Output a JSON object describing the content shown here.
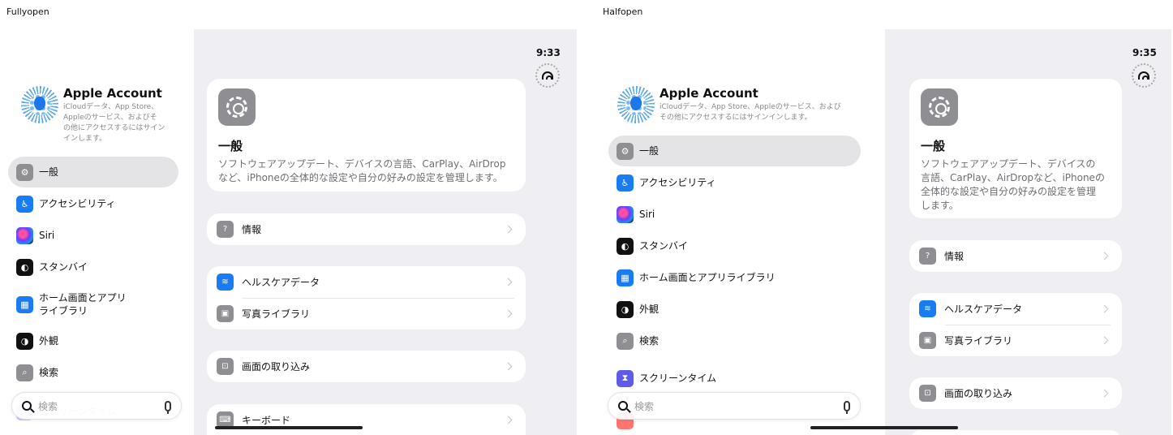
{
  "captions": {
    "left": "Fullyopen",
    "right": "Halfopen"
  },
  "status": {
    "time_left": "9:33",
    "time_right": "9:35"
  },
  "account": {
    "title": "Apple Account",
    "subtitle_left": [
      "iCloudデータ、App Store、",
      "Appleのサービス、およびそ",
      "の他にアクセスするにはサイン",
      "インします。"
    ],
    "subtitle_right": [
      "iCloudデータ、App Store、Appleのサービス、および",
      "その他にアクセスするにはサインインします。"
    ]
  },
  "sidebar": {
    "items": [
      {
        "label": "一般",
        "icon": "gear-icon"
      },
      {
        "label": "アクセシビリティ",
        "icon": "accessibility-icon"
      },
      {
        "label": "Siri",
        "icon": "siri-icon"
      },
      {
        "label": "スタンバイ",
        "icon": "standby-icon"
      },
      {
        "label": "ホーム画面とアプリライブラリ",
        "icon": "home-screen-icon"
      },
      {
        "label": "外観",
        "icon": "appearance-icon"
      },
      {
        "label": "検索",
        "icon": "search-icon"
      },
      {
        "label": "スクリーンタイム",
        "icon": "screen-time-icon"
      }
    ],
    "home_label_left": [
      "ホーム画面とアプリ",
      "ライブラリ"
    ]
  },
  "search": {
    "placeholder": "検索"
  },
  "detail": {
    "hero": {
      "title": "一般",
      "desc_left": [
        "ソフトウェアアップデート、デバイスの言語、CarPlay、AirDrop",
        "など、iPhoneの全体的な設定や自分の好みの設定を管理します。"
      ],
      "desc_right": [
        "ソフトウェアアップデート、デバイスの",
        "言語、CarPlay、AirDropなど、iPhoneの",
        "全体的な設定や自分の好みの設定を管理",
        "します。"
      ]
    },
    "info": "情報",
    "health": "ヘルスケアデータ",
    "photos": "写真ライブラリ",
    "capture": "画面の取り込み",
    "keyboard": "キーボード"
  }
}
